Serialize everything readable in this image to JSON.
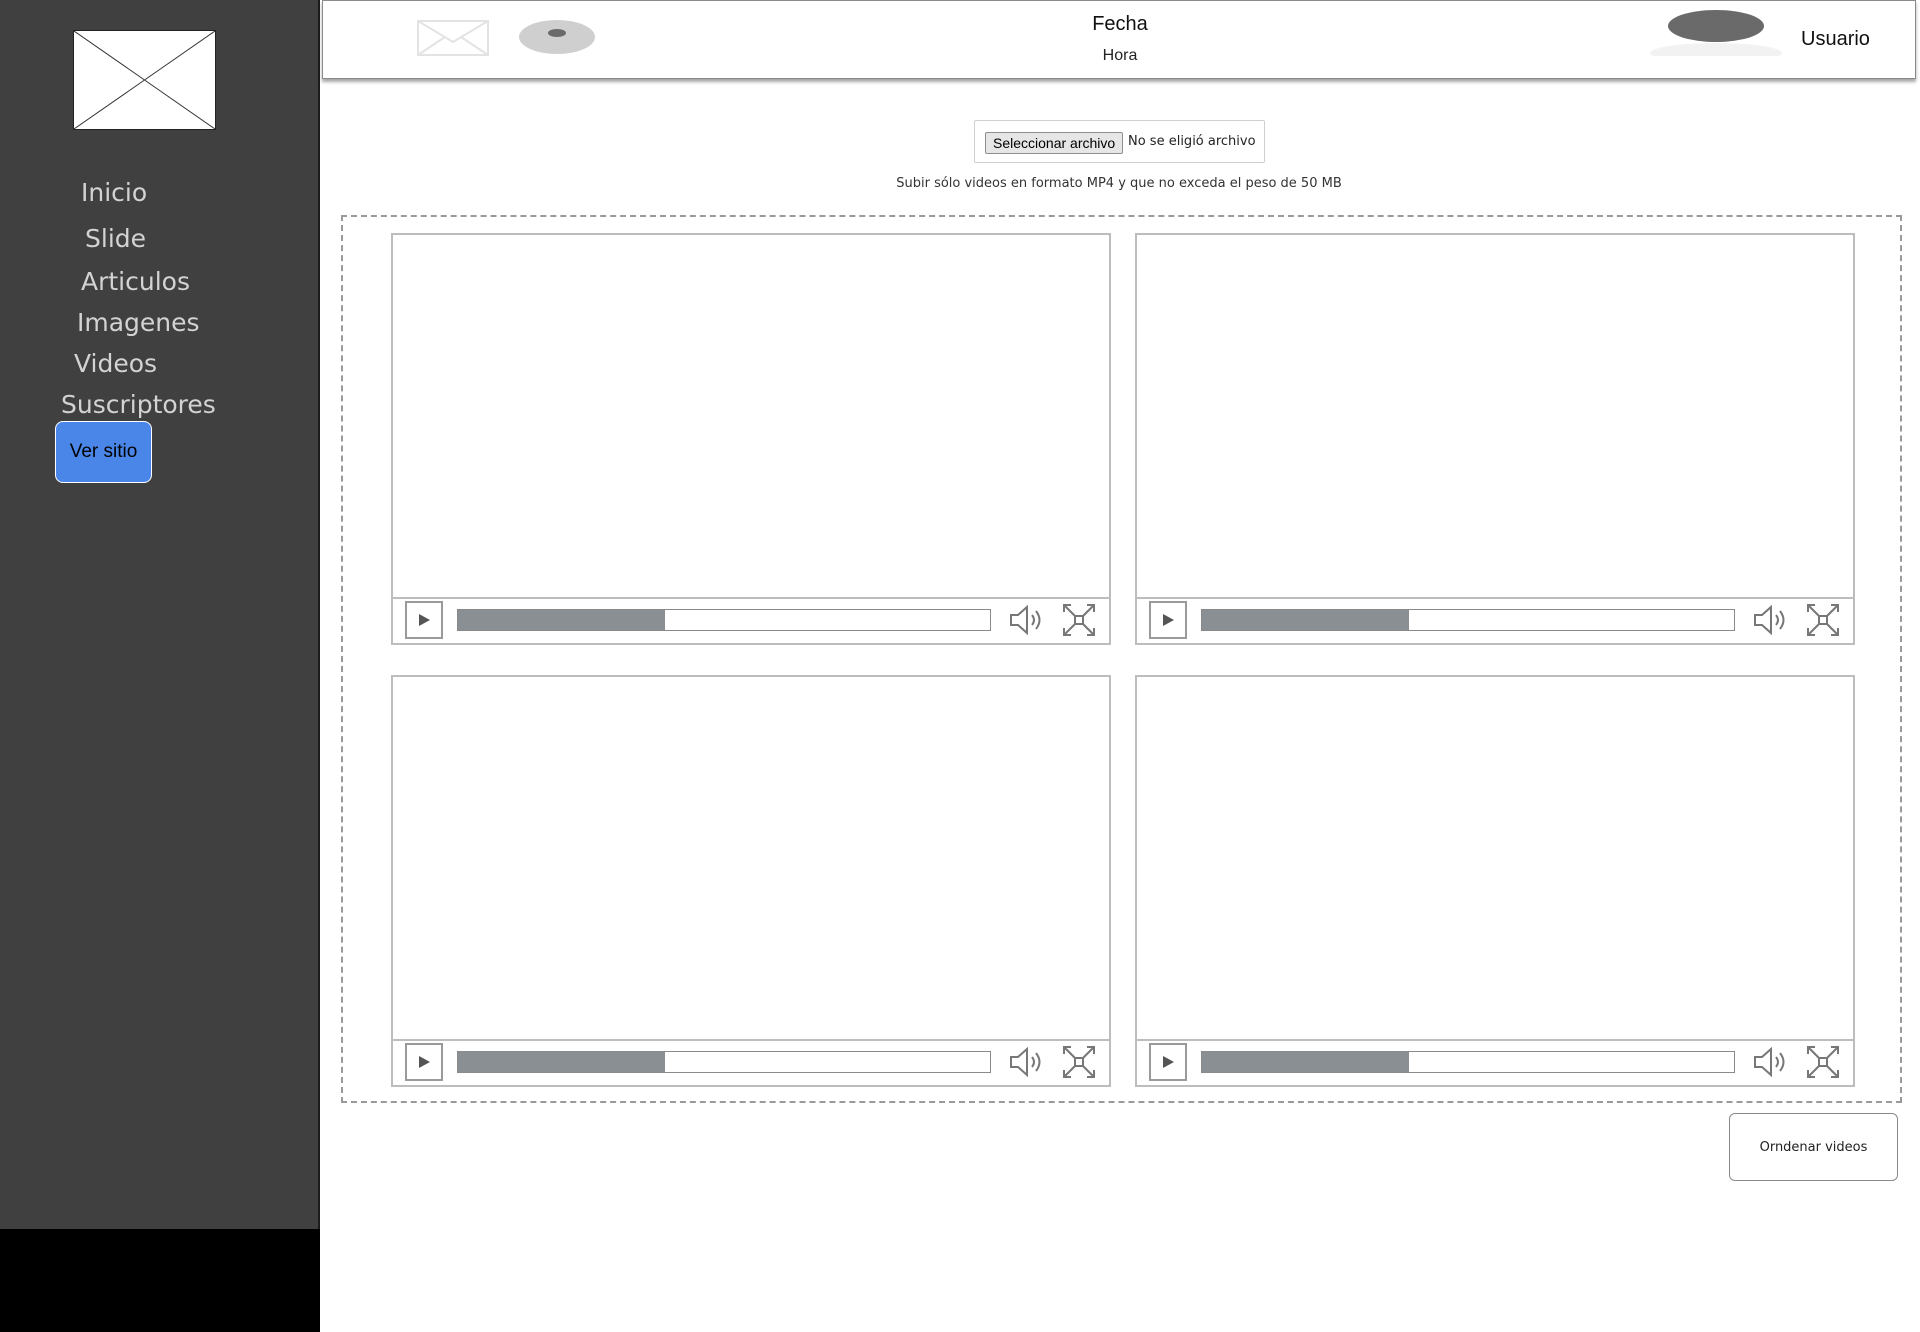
{
  "sidebar": {
    "logo_icon": "image-placeholder-icon",
    "items": [
      {
        "label": "Inicio"
      },
      {
        "label": "Slide"
      },
      {
        "label": "Articulos"
      },
      {
        "label": "Imagenes"
      },
      {
        "label": "Videos"
      },
      {
        "label": "Suscriptores"
      }
    ],
    "view_site_label": "Ver sitio",
    "accent_color": "#4a86e8"
  },
  "header": {
    "mail_icon": "mail-icon",
    "notification_icon": "disc-icon",
    "date_label": "Fecha",
    "time_label": "Hora",
    "avatar_icon": "avatar-icon",
    "user_label": "Usuario"
  },
  "upload": {
    "button_label": "Seleccionar archivo",
    "status": "No se eligió archivo",
    "hint": "Subir sólo videos en formato MP4 y que no exceda el peso de 50 MB"
  },
  "videos": [
    {
      "progress": 0.39
    },
    {
      "progress": 0.39
    },
    {
      "progress": 0.39
    },
    {
      "progress": 0.39
    }
  ],
  "actions": {
    "order_label": "Orndenar videos"
  }
}
